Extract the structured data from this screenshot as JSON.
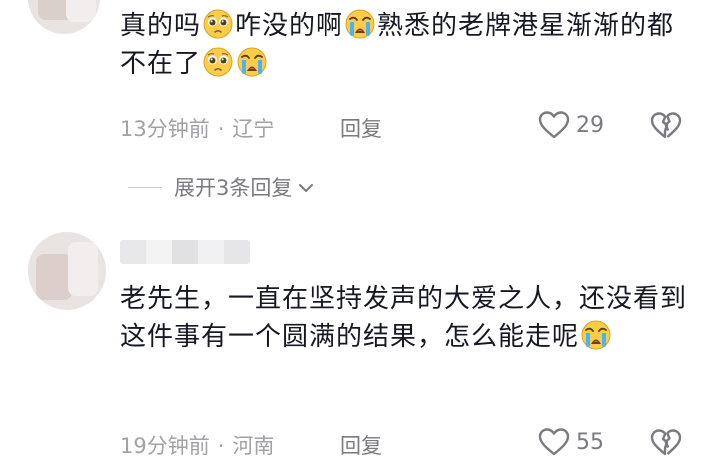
{
  "comments": [
    {
      "segments": [
        {
          "type": "text",
          "value": "真的吗"
        },
        {
          "type": "emoji",
          "name": "pleading-face-emoji"
        },
        {
          "type": "text",
          "value": "咋没的啊"
        },
        {
          "type": "emoji",
          "name": "crying-face-emoji"
        },
        {
          "type": "text",
          "value": "熟悉的老牌港星渐渐的都不在了"
        },
        {
          "type": "emoji",
          "name": "pleading-face-emoji"
        },
        {
          "type": "emoji",
          "name": "crying-face-emoji"
        }
      ],
      "time": "13分钟前",
      "location": "辽宁",
      "reply_label": "回复",
      "likes": "29"
    },
    {
      "segments": [
        {
          "type": "text",
          "value": "老先生，一直在坚持发声的大爱之人，还没看到这件事有一个圆满的结果，怎么能走呢"
        },
        {
          "type": "emoji",
          "name": "crying-face-emoji"
        }
      ],
      "time": "19分钟前",
      "location": "河南",
      "reply_label": "回复",
      "likes": "55"
    }
  ],
  "expand_replies": {
    "label": "展开3条回复"
  },
  "colors": {
    "text": "#161823",
    "meta": "#a1a1a6",
    "action": "#7a7a80"
  }
}
